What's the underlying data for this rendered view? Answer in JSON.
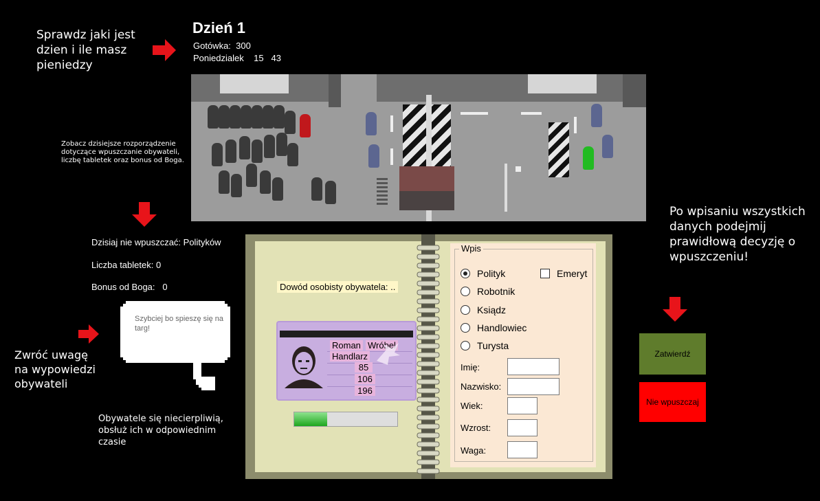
{
  "hud": {
    "day_title": "Dzień 1",
    "cash_label": "Gotówka:",
    "cash_value": "300",
    "weekday": "Poniedzialek",
    "hour": "15",
    "minute": "43"
  },
  "rules": {
    "no_entry": "Dzisiaj nie wpuszczać: Polityków",
    "tablets": "Liczba tabletek: 0",
    "bonus": "Bonus od Boga:   0"
  },
  "speech": "Szybciej bo spieszę się na targ!",
  "hints": {
    "top_left": "Sprawdz jaki jest dzien i ile masz pieniedzy",
    "rules_hint": "Zobacz dzisiejsze rozporządzenie dotyczące wpuszczanie obywateli, liczbę tabletek oraz bonus od Boga.",
    "speech_hint": "Zwróć uwagę na wypowiedzi obywateli",
    "patience_hint": "Obywatele się niecierpliwią, obsłuż ich w odpowiednim czasie",
    "decision_hint": "Po wpisaniu wszystkich danych podejmij prawidłową decyzję o wpuszczeniu!"
  },
  "id_card": {
    "caption": "Dowód osobisty obywatela: ..",
    "first_name": "Roman",
    "last_name": "Wróbel",
    "profession": "Handlarz",
    "age": "85",
    "height": "106",
    "weight": "196"
  },
  "patience": 0.32,
  "form": {
    "group_title": "Wpis",
    "professions": [
      {
        "label": "Polityk",
        "selected": true
      },
      {
        "label": "Robotnik",
        "selected": false
      },
      {
        "label": "Ksiądz",
        "selected": false
      },
      {
        "label": "Handlowiec",
        "selected": false
      },
      {
        "label": "Turysta",
        "selected": false
      }
    ],
    "retired_label": "Emeryt",
    "retired_checked": false,
    "fields": {
      "first_name": {
        "label": "Imię:",
        "value": ""
      },
      "last_name": {
        "label": "Nazwisko:",
        "value": ""
      },
      "age": {
        "label": "Wiek:",
        "value": ""
      },
      "height": {
        "label": "Wzrost:",
        "value": ""
      },
      "weight": {
        "label": "Waga:",
        "value": ""
      }
    }
  },
  "buttons": {
    "approve": "Zatwierdź",
    "reject": "Nie wpuszczaj"
  },
  "colors": {
    "arrow": "#e8141a",
    "approve_bg": "#5f7c2c",
    "reject_bg": "#ff0000",
    "suspect": "#c0181c",
    "guard": "#5c6690",
    "friend": "#22bb22"
  }
}
